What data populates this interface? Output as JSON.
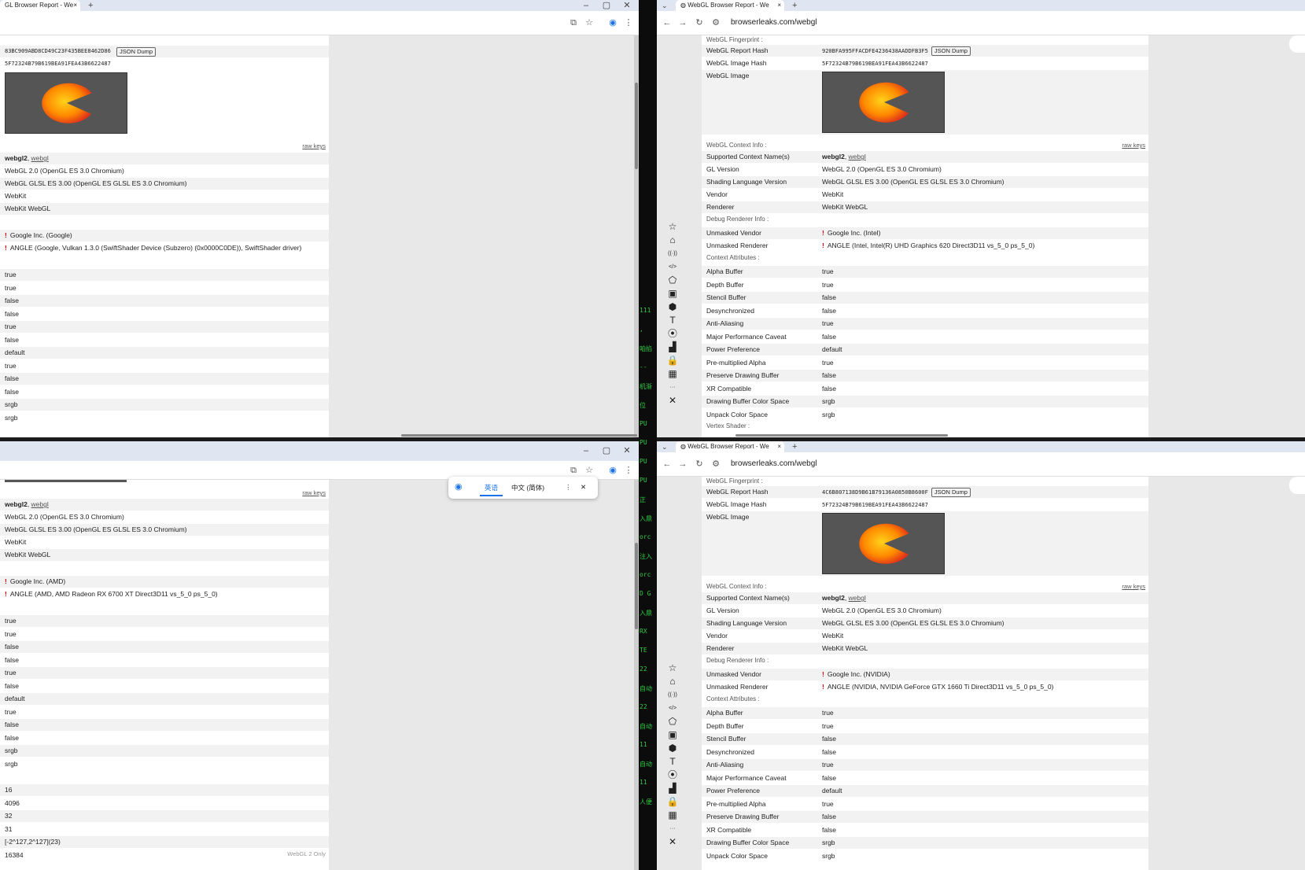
{
  "browser": {
    "tab_title": "WebGL Browser Report - We",
    "tab_title_left": "GL Browser Report - We",
    "url": "browserleaks.com/webgl",
    "tab_close": "×",
    "new_tab": "+",
    "minimize": "–",
    "maximize": "▢",
    "close": "✕"
  },
  "labels": {
    "fingerprint_section": "WebGL Fingerprint :",
    "report_hash": "WebGL Report Hash",
    "image_hash": "WebGL Image Hash",
    "webgl_image": "WebGL Image",
    "context_info_section": "WebGL Context Info :",
    "raw_keys": "raw keys",
    "supported_context": "Supported Context Name(s)",
    "gl_version": "GL Version",
    "shading_language": "Shading Language Version",
    "vendor": "Vendor",
    "renderer": "Renderer",
    "debug_section": "Debug Renderer Info :",
    "unmasked_vendor": "Unmasked Vendor",
    "unmasked_renderer": "Unmasked Renderer",
    "context_attrs_section": "Context Attributes :",
    "alpha_buffer": "Alpha Buffer",
    "depth_buffer": "Depth Buffer",
    "stencil_buffer": "Stencil Buffer",
    "desynchronized": "Desynchronized",
    "anti_aliasing": "Anti-Aliasing",
    "major_perf": "Major Performance Caveat",
    "power_pref": "Power Preference",
    "premult_alpha": "Pre-multiplied Alpha",
    "preserve_drawing": "Preserve Drawing Buffer",
    "xr_compatible": "XR Compatible",
    "drawing_color_space": "Drawing Buffer Color Space",
    "unpack_color_space": "Unpack Color Space",
    "vertex_shader_section": "Vertex Shader :",
    "json_dump": "JSON Dump"
  },
  "common": {
    "context_bold": "webgl2",
    "context_sep": ", ",
    "context_link": "webgl",
    "gl_version": "WebGL 2.0 (OpenGL ES 3.0 Chromium)",
    "shading": "WebGL GLSL ES 3.00 (OpenGL ES GLSL ES 3.0 Chromium)",
    "vendor": "WebKit",
    "renderer": "WebKit WebGL",
    "image_hash": "5F72324B79B619BEA91FEA43B6622487",
    "attrs": [
      "true",
      "true",
      "false",
      "false",
      "true",
      "false",
      "default",
      "true",
      "false",
      "false",
      "srgb",
      "srgb"
    ]
  },
  "windows": {
    "tl": {
      "report_hash": "83BC909ABD8CD49C23F435BEE8462D86",
      "unmasked_vendor": "Google Inc. (Google)",
      "unmasked_renderer": "ANGLE (Google, Vulkan 1.3.0 (SwiftShader Device (Subzero) (0x0000C0DE)), SwiftShader driver)"
    },
    "tr": {
      "report_hash": "920BFA995FFACDFE4236438AADDFB3F5",
      "unmasked_vendor": "Google Inc. (Intel)",
      "unmasked_renderer": "ANGLE (Intel, Intel(R) UHD Graphics 620 Direct3D11 vs_5_0 ps_5_0)"
    },
    "bl": {
      "unmasked_vendor": "Google Inc. (AMD)",
      "unmasked_renderer": "ANGLE (AMD, AMD Radeon RX 6700 XT Direct3D11 vs_5_0 ps_5_0)",
      "extra_values": [
        "16",
        "4096",
        "32",
        "31",
        "[-2^127,2^127](23)",
        "16384"
      ],
      "webgl2_only": "WebGL 2 Only"
    },
    "br": {
      "report_hash": "4C6B807138D9B61B79136A0850B8600F",
      "unmasked_vendor": "Google Inc. (NVIDIA)",
      "unmasked_renderer": "ANGLE (NVIDIA, NVIDIA GeForce GTX 1660 Ti Direct3D11 vs_5_0 ps_5_0)"
    }
  },
  "translate_popup": {
    "source": "英语",
    "target": "中文 (简体)",
    "more": "⋮",
    "close": "✕"
  },
  "terminal_lines": [
    "111",
    ",",
    "咱掐",
    "--",
    "机渐",
    "位",
    "PU",
    "PU",
    "PU",
    "PU",
    "正",
    "入鼎",
    "orc",
    "注入",
    "orc",
    "D G",
    "入鼎",
    "RX",
    "TE",
    "22",
    "自动",
    "22",
    "自动",
    "11",
    "自动",
    "11",
    "人便"
  ]
}
